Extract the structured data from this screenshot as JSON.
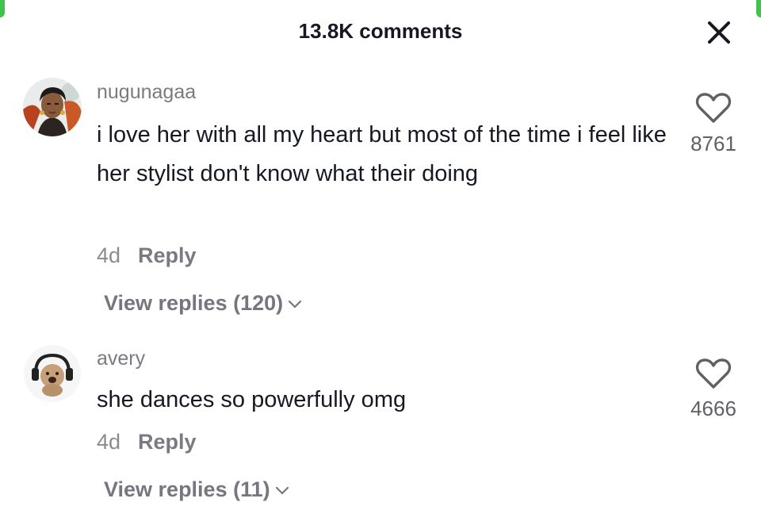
{
  "header": {
    "title": "13.8K comments"
  },
  "comments": [
    {
      "username": "nugunagaa",
      "text": "i love her with all my heart but most of the time i feel like her stylist don't know what their doing",
      "date": "4d",
      "reply_label": "Reply",
      "view_replies": "View replies (120)",
      "likes": "8761"
    },
    {
      "username": "avery",
      "text": "she dances so powerfully omg",
      "date": "4d",
      "reply_label": "Reply",
      "view_replies": "View replies (11)",
      "likes": "4666"
    }
  ],
  "colors": {
    "accent_green": "#3fc44a",
    "primary_text": "#161823",
    "secondary_text": "#7a7b82"
  },
  "icons": {
    "close": "close-icon",
    "like": "heart-outline-icon",
    "expand": "chevron-down-icon"
  }
}
